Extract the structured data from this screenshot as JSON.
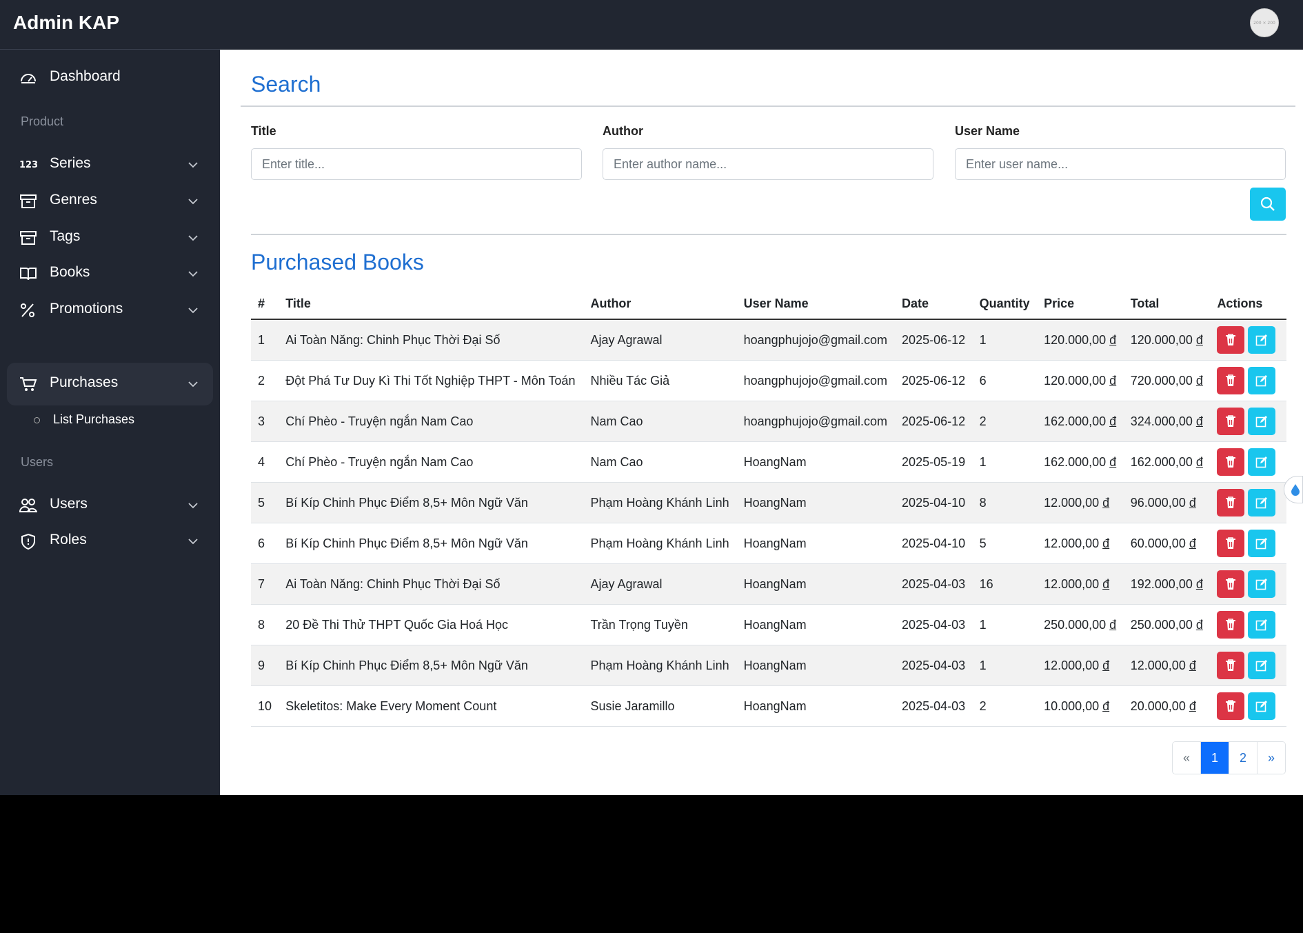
{
  "app": {
    "brand": "Admin KAP",
    "avatar_text": "200 × 200"
  },
  "sidebar": {
    "dashboard": "Dashboard",
    "section_product": "Product",
    "series": "Series",
    "genres": "Genres",
    "tags": "Tags",
    "books": "Books",
    "promotions": "Promotions",
    "purchases": "Purchases",
    "list_purchases": "List Purchases",
    "section_users": "Users",
    "users": "Users",
    "roles": "Roles"
  },
  "search": {
    "heading": "Search",
    "title_label": "Title",
    "title_placeholder": "Enter title...",
    "author_label": "Author",
    "author_placeholder": "Enter author name...",
    "username_label": "User Name",
    "username_placeholder": "Enter user name..."
  },
  "purchased": {
    "heading": "Purchased Books",
    "columns": [
      "#",
      "Title",
      "Author",
      "User Name",
      "Date",
      "Quantity",
      "Price",
      "Total",
      "Actions"
    ],
    "rows": [
      [
        "1",
        "Ai Toàn Năng: Chinh Phục Thời Đại Số",
        "Ajay Agrawal",
        "hoangphujojo@gmail.com",
        "2025-06-12",
        "1",
        "120.000,00",
        "120.000,00"
      ],
      [
        "2",
        "Đột Phá Tư Duy Kì Thi Tốt Nghiệp THPT - Môn Toán",
        "Nhiều Tác Giả",
        "hoangphujojo@gmail.com",
        "2025-06-12",
        "6",
        "120.000,00",
        "720.000,00"
      ],
      [
        "3",
        "Chí Phèo - Truyện ngắn Nam Cao",
        "Nam Cao",
        "hoangphujojo@gmail.com",
        "2025-06-12",
        "2",
        "162.000,00",
        "324.000,00"
      ],
      [
        "4",
        "Chí Phèo - Truyện ngắn Nam Cao",
        "Nam Cao",
        "HoangNam",
        "2025-05-19",
        "1",
        "162.000,00",
        "162.000,00"
      ],
      [
        "5",
        "Bí Kíp Chinh Phục Điểm 8,5+ Môn Ngữ Văn",
        "Phạm Hoàng Khánh Linh",
        "HoangNam",
        "2025-04-10",
        "8",
        "12.000,00",
        "96.000,00"
      ],
      [
        "6",
        "Bí Kíp Chinh Phục Điểm 8,5+ Môn Ngữ Văn",
        "Phạm Hoàng Khánh Linh",
        "HoangNam",
        "2025-04-10",
        "5",
        "12.000,00",
        "60.000,00"
      ],
      [
        "7",
        "Ai Toàn Năng: Chinh Phục Thời Đại Số",
        "Ajay Agrawal",
        "HoangNam",
        "2025-04-03",
        "16",
        "12.000,00",
        "192.000,00"
      ],
      [
        "8",
        "20 Đề Thi Thử THPT Quốc Gia Hoá Học",
        "Trần Trọng Tuyền",
        "HoangNam",
        "2025-04-03",
        "1",
        "250.000,00",
        "250.000,00"
      ],
      [
        "9",
        "Bí Kíp Chinh Phục Điểm 8,5+ Môn Ngữ Văn",
        "Phạm Hoàng Khánh Linh",
        "HoangNam",
        "2025-04-03",
        "1",
        "12.000,00",
        "12.000,00"
      ],
      [
        "10",
        "Skeletitos: Make Every Moment Count",
        "Susie Jaramillo",
        "HoangNam",
        "2025-04-03",
        "2",
        "10.000,00",
        "20.000,00"
      ]
    ],
    "currency": "đ"
  },
  "pagination": {
    "prev": "«",
    "pages": [
      "1",
      "2"
    ],
    "next": "»",
    "current": "1"
  },
  "colors": {
    "sidebar": "#212631",
    "accent": "#1f6fd1",
    "danger": "#dc3545",
    "info": "#19c6ee"
  }
}
